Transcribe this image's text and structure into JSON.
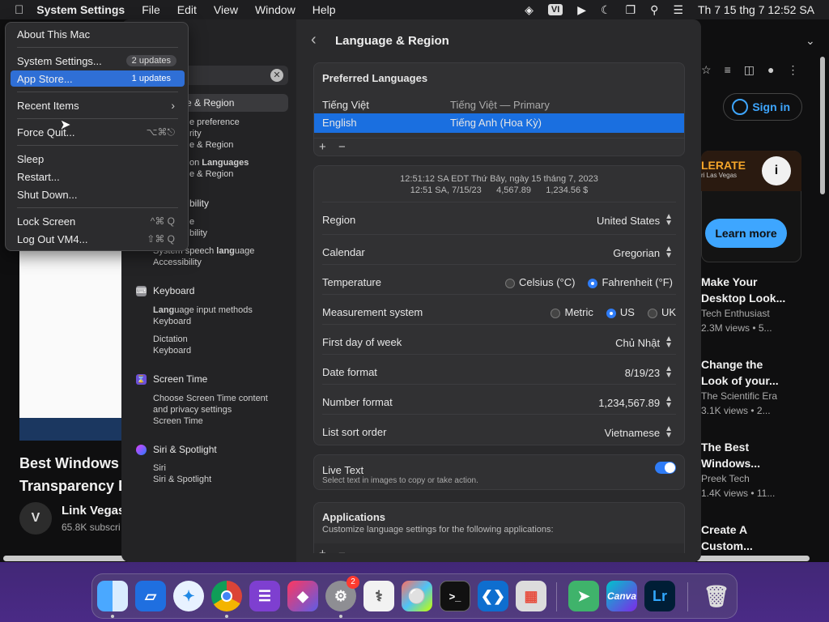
{
  "menubar": {
    "apple": "",
    "app": "System Settings",
    "items": [
      "File",
      "Edit",
      "View",
      "Window",
      "Help"
    ],
    "input_source": "VI",
    "clock": "Th 7 15 thg 7  12:52 SA"
  },
  "apple_menu": {
    "about": "About This Mac",
    "settings": "System Settings...",
    "settings_badge": "2 updates",
    "appstore": "App Store...",
    "appstore_badge": "1 updates",
    "recent": "Recent Items",
    "force_quit": "Force Quit...",
    "force_quit_sc": "⌥⌘⎋",
    "sleep": "Sleep",
    "restart": "Restart...",
    "shutdown": "Shut Down...",
    "lock": "Lock Screen",
    "lock_sc": "^⌘ Q",
    "logout": "Log Out VM4...",
    "logout_sc": "⇧⌘ Q"
  },
  "sidebar": {
    "selected": "e & Region",
    "r1": "e preference",
    "r2": "rity",
    "r3": "e & Region",
    "r4a": "on ",
    "r4b": "Languages",
    "r5": "e & Region",
    "r6": "bility",
    "r7": "e",
    "r8": "bility",
    "r9a": "System speech ",
    "r9b": "lang",
    "r9c": "uage",
    "r10": "Accessibility",
    "keyboard": "Keyboard",
    "kb1a": "Lang",
    "kb1b": "uage input methods",
    "kb2": "Keyboard",
    "kb3": "Dictation",
    "kb4": "Keyboard",
    "screentime": "Screen Time",
    "st1": "Choose Screen Time content",
    "st2": "and privacy settings",
    "st3": "Screen Time",
    "siri": "Siri & Spotlight",
    "siri1": "Siri",
    "siri2": "Siri & Spotlight"
  },
  "main": {
    "title": "Language & Region",
    "preferred_header": "Preferred Languages",
    "lang1": "Tiếng Việt",
    "lang1_desc": "Tiếng Việt — Primary",
    "lang2": "English",
    "lang2_desc": "Tiếng Anh (Hoa Kỳ)",
    "add": "+",
    "remove": "−",
    "preview1": "12:51:12 SA EDT Thứ Bảy, ngày 15 tháng 7, 2023",
    "preview2": "12:51 SA, 7/15/23      4,567.89      1,234.56 $",
    "region_label": "Region",
    "region_value": "United States",
    "calendar_label": "Calendar",
    "calendar_value": "Gregorian",
    "temp_label": "Temperature",
    "temp_c": "Celsius (°C)",
    "temp_f": "Fahrenheit (°F)",
    "meas_label": "Measurement system",
    "meas_metric": "Metric",
    "meas_us": "US",
    "meas_uk": "UK",
    "week_label": "First day of week",
    "week_value": "Chủ Nhật",
    "date_label": "Date format",
    "date_value": "8/19/23",
    "num_label": "Number format",
    "num_value": "1,234,567.89",
    "sort_label": "List sort order",
    "sort_value": "Vietnamese",
    "livetext_label": "Live Text",
    "livetext_desc": "Select text in images to copy or take action.",
    "apps_header": "Applications",
    "apps_desc": "Customize language settings for the following applications:"
  },
  "browser": {
    "signin": "Sign in",
    "ad_text": "LERATE",
    "ad_sub": "ri Las Vegas",
    "learn_more": "Learn more",
    "v1t1": "Make Your",
    "v1t2": "Desktop Look...",
    "v1c": "Tech Enthusiast",
    "v1m": "2.3M views  •  5...",
    "v2t1": "Change the",
    "v2t2": "Look of your...",
    "v2c": "The Scientific Era",
    "v2m": "3.1K views  •  2...",
    "v3t1": "The Best",
    "v3t2": "Windows...",
    "v3c": "Preek Tech",
    "v3m": "1.4K views  •  11...",
    "v4t1": "Create A",
    "v4t2": "Custom...",
    "big1": "Best Windows 1",
    "big2": "Transparency E",
    "channel": "Link Vegas",
    "subs": "65.8K subscri"
  },
  "dock": {
    "settings_badge": "2",
    "canva": "Canva",
    "lr": "Lr"
  }
}
